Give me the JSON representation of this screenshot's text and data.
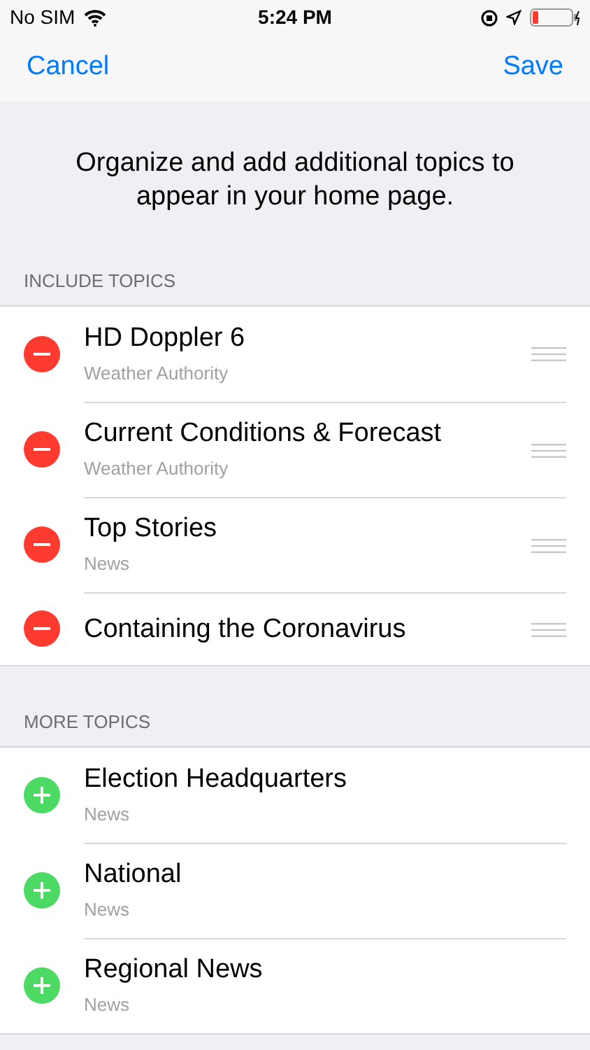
{
  "status_bar": {
    "carrier": "No SIM",
    "time": "5:24 PM"
  },
  "nav": {
    "cancel": "Cancel",
    "save": "Save"
  },
  "intro": "Organize and add additional topics to appear in your home page.",
  "sections": [
    {
      "header": "INCLUDE TOPICS",
      "kind": "remove",
      "items": [
        {
          "title": "HD Doppler 6",
          "subtitle": "Weather Authority"
        },
        {
          "title": "Current Conditions & Forecast",
          "subtitle": "Weather Authority"
        },
        {
          "title": "Top Stories",
          "subtitle": "News"
        },
        {
          "title": "Containing the Coronavirus"
        }
      ]
    },
    {
      "header": "MORE TOPICS",
      "kind": "add",
      "items": [
        {
          "title": "Election Headquarters",
          "subtitle": "News"
        },
        {
          "title": "National",
          "subtitle": "News"
        },
        {
          "title": "Regional News",
          "subtitle": "News"
        }
      ]
    }
  ]
}
